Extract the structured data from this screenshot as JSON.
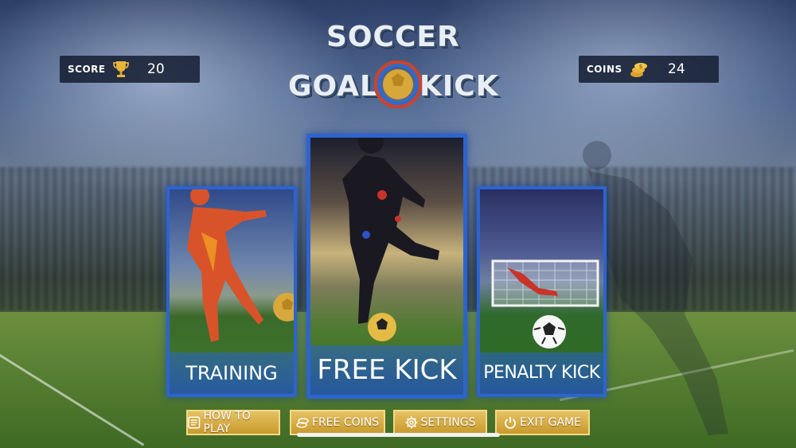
{
  "hud": {
    "score_label": "SCORE",
    "score_value": "20",
    "coins_label": "COINS",
    "coins_value": "24"
  },
  "title": {
    "line1": "SOCCER",
    "line2_left": "GOAL",
    "line2_right": "KICK"
  },
  "modes": [
    {
      "label": "TRAINING"
    },
    {
      "label": "FREE KICK"
    },
    {
      "label": "PENALTY KICK"
    }
  ],
  "buttons": {
    "how_to_play": "HOW TO PLAY",
    "free_coins": "FREE COINS",
    "settings": "SETTINGS",
    "exit_game": "EXIT GAME"
  },
  "colors": {
    "card_border": "#2d64cf",
    "button_gold": "#d8ad45"
  },
  "icons": [
    "trophy-icon",
    "coins-icon",
    "info-icon",
    "free-coins-icon",
    "gear-icon",
    "power-icon"
  ]
}
